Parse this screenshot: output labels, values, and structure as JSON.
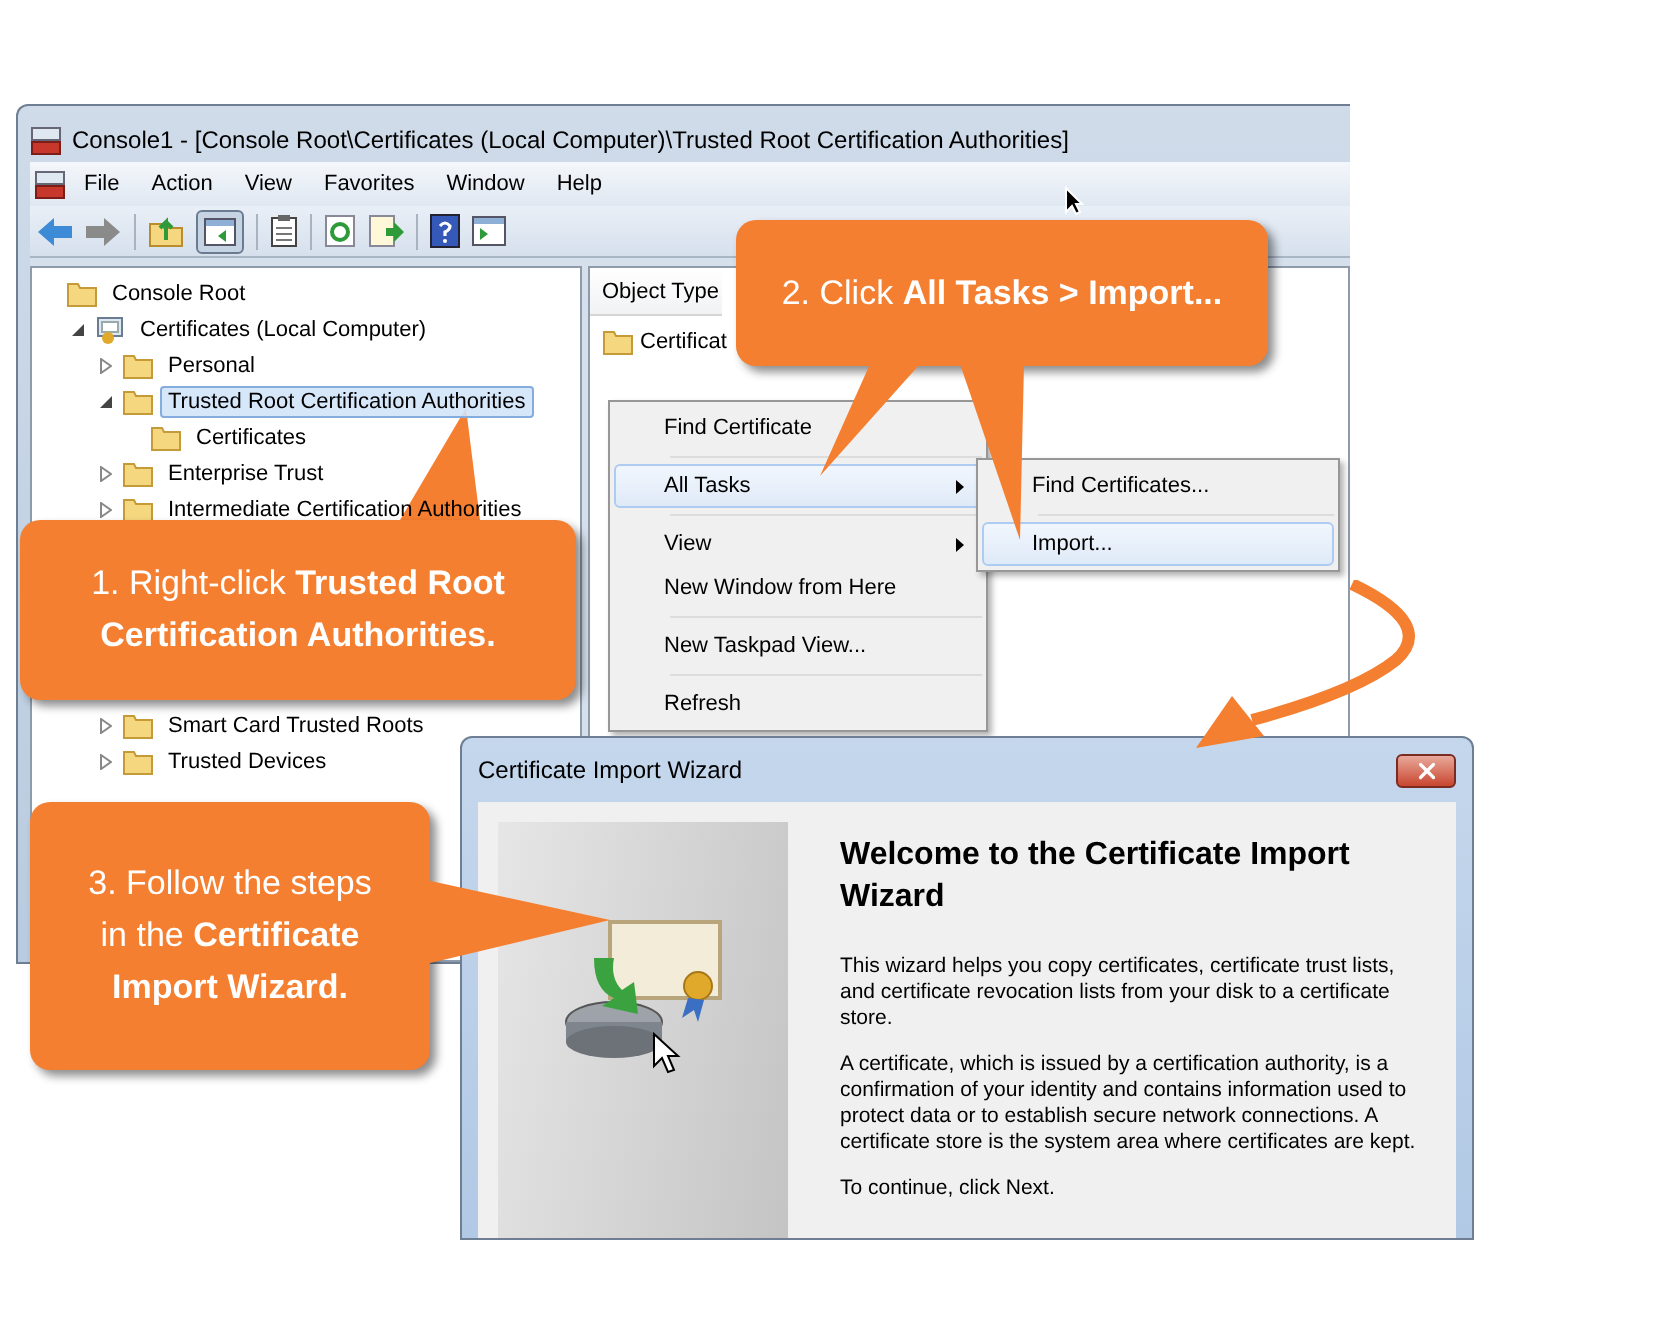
{
  "mmc": {
    "title": "Console1 - [Console Root\\Certificates (Local Computer)\\Trusted Root Certification Authorities]",
    "menu": [
      "File",
      "Action",
      "View",
      "Favorites",
      "Window",
      "Help"
    ],
    "toolbar": {
      "console_tree_pressed": true
    },
    "tree": [
      {
        "label": "Console Root",
        "kind": "folder",
        "selected": false,
        "children": [
          {
            "label": "Certificates (Local Computer)",
            "kind": "snapin",
            "selected": false,
            "expanded": true,
            "children": [
              {
                "label": "Personal",
                "kind": "folder",
                "selected": false,
                "expanded": false
              },
              {
                "label": "Trusted Root Certification Authorities",
                "kind": "folder",
                "selected": true,
                "expanded": true,
                "children": [
                  {
                    "label": "Certificates",
                    "kind": "folder",
                    "selected": false
                  }
                ]
              },
              {
                "label": "Enterprise Trust",
                "kind": "folder",
                "selected": false,
                "expanded": false
              },
              {
                "label": "Intermediate Certification Authorities",
                "kind": "folder",
                "selected": false,
                "expanded": false
              },
              {
                "label": "Smart Card Trusted Roots",
                "kind": "folder",
                "selected": false,
                "expanded": false
              },
              {
                "label": "Trusted Devices",
                "kind": "folder",
                "selected": false,
                "expanded": false
              }
            ]
          }
        ]
      }
    ],
    "list": {
      "column": "Object Type",
      "rows": [
        "Certificat"
      ]
    }
  },
  "context_menu": [
    {
      "kind": "item",
      "label": "Find Certificate",
      "selected": false,
      "submenu": false
    },
    {
      "kind": "separator"
    },
    {
      "kind": "item",
      "label": "All Tasks",
      "selected": true,
      "submenu": true
    },
    {
      "kind": "separator"
    },
    {
      "kind": "item",
      "label": "View",
      "selected": false,
      "submenu": true
    },
    {
      "kind": "item",
      "label": "New Window from Here",
      "selected": false,
      "submenu": false
    },
    {
      "kind": "separator"
    },
    {
      "kind": "item",
      "label": "New Taskpad View...",
      "selected": false,
      "submenu": false
    },
    {
      "kind": "separator"
    },
    {
      "kind": "item",
      "label": "Refresh",
      "selected": false,
      "submenu": false
    }
  ],
  "submenu": [
    {
      "kind": "item",
      "label": "Find Certificates...",
      "selected": false
    },
    {
      "kind": "separator"
    },
    {
      "kind": "item",
      "label": "Import...",
      "selected": true
    }
  ],
  "callouts": [
    "1. Right-click **Trusted Root Certification Authorities.**",
    "2. Click **All Tasks > Import...**",
    "3. Follow the steps in the **Certificate Import Wizard.**"
  ],
  "wizard": {
    "title": "Certificate Import Wizard",
    "heading": "Welcome to the Certificate Import Wizard",
    "paragraphs": [
      "This wizard helps you copy certificates, certificate trust lists, and certificate revocation lists from your disk to a certificate store.",
      "A certificate, which is issued by a certification authority, is a confirmation of your identity and contains information used to protect data or to establish secure network connections. A certificate store is the system area where certificates are kept.",
      "To continue, click Next."
    ]
  }
}
